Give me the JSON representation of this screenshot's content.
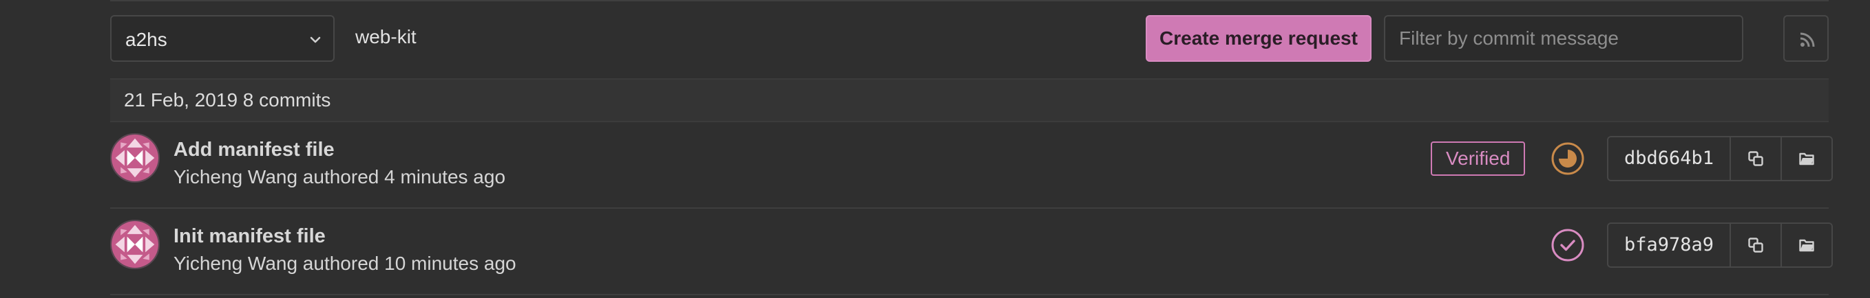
{
  "toolbar": {
    "ref_value": "a2hs",
    "path": "web-kit",
    "create_mr_label": "Create merge request",
    "filter_placeholder": "Filter by commit message",
    "filter_value": "",
    "icons": {
      "ref_dropdown": "chevron-down-icon",
      "feed": "rss-icon"
    }
  },
  "day_group": {
    "label": "21 Feb, 2019 8 commits"
  },
  "commits": [
    {
      "title": "Add manifest file",
      "meta": "Yicheng Wang authored 4 minutes ago",
      "verified_label": "Verified",
      "pipeline_status": "running",
      "sha": "dbd664b1",
      "icons": [
        "copy-icon",
        "folder-icon"
      ]
    },
    {
      "title": "Init manifest file",
      "meta": "Yicheng Wang authored 10 minutes ago",
      "verified_label": "",
      "pipeline_status": "passed",
      "sha": "bfa978a9",
      "icons": [
        "copy-icon",
        "folder-icon"
      ]
    }
  ],
  "colors": {
    "accent": "#cf7ab4",
    "running": "#c98a4a",
    "passed": "#d98cc2",
    "background": "#2f2f2f"
  }
}
